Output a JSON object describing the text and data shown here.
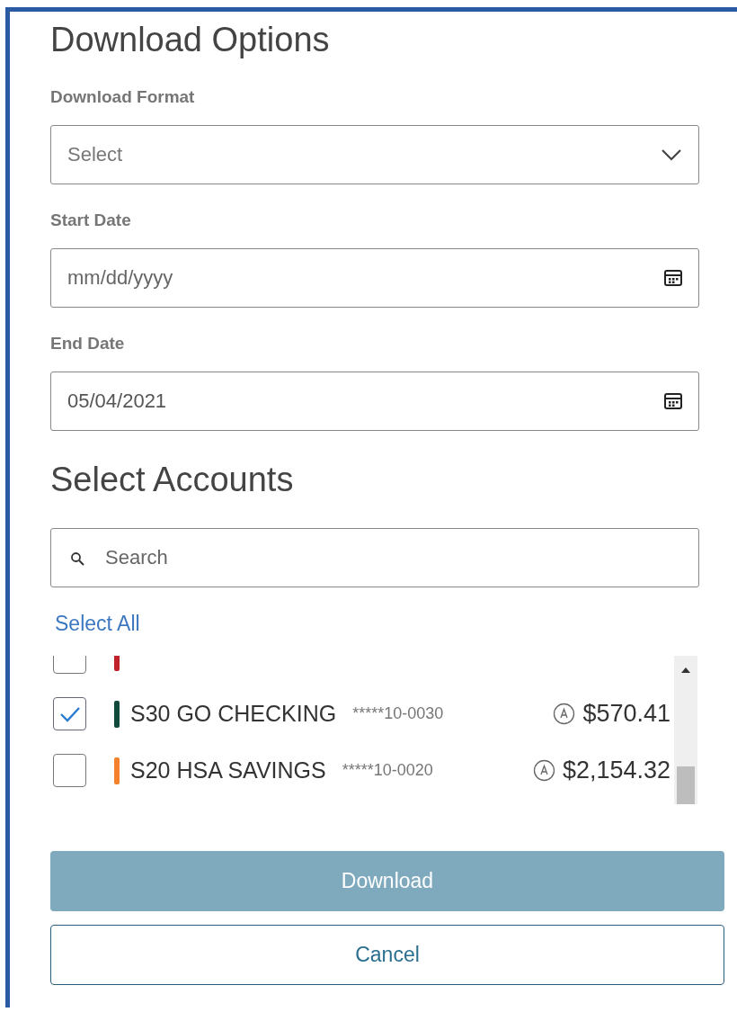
{
  "title": "Download Options",
  "format": {
    "label": "Download Format",
    "placeholder": "Select"
  },
  "start_date": {
    "label": "Start Date",
    "placeholder": "mm/dd/yyyy"
  },
  "end_date": {
    "label": "End Date",
    "value": "05/04/2021"
  },
  "accounts": {
    "title": "Select Accounts",
    "search": {
      "placeholder": "Search"
    },
    "select_all": "Select All",
    "rows": [
      {
        "checked": false,
        "color": "#c0222a"
      },
      {
        "checked": true,
        "color": "#0f4a3c",
        "name": "S30 GO CHECKING",
        "number": "*****10-0030",
        "amount": "$570.41"
      },
      {
        "checked": false,
        "color": "#f5822a",
        "name": "S20 HSA SAVINGS",
        "number": "*****10-0020",
        "amount": "$2,154.32"
      }
    ]
  },
  "buttons": [
    {
      "label": "Download",
      "kind": "primary",
      "disabled": true
    },
    {
      "label": "Cancel",
      "kind": "secondary",
      "disabled": false
    }
  ]
}
